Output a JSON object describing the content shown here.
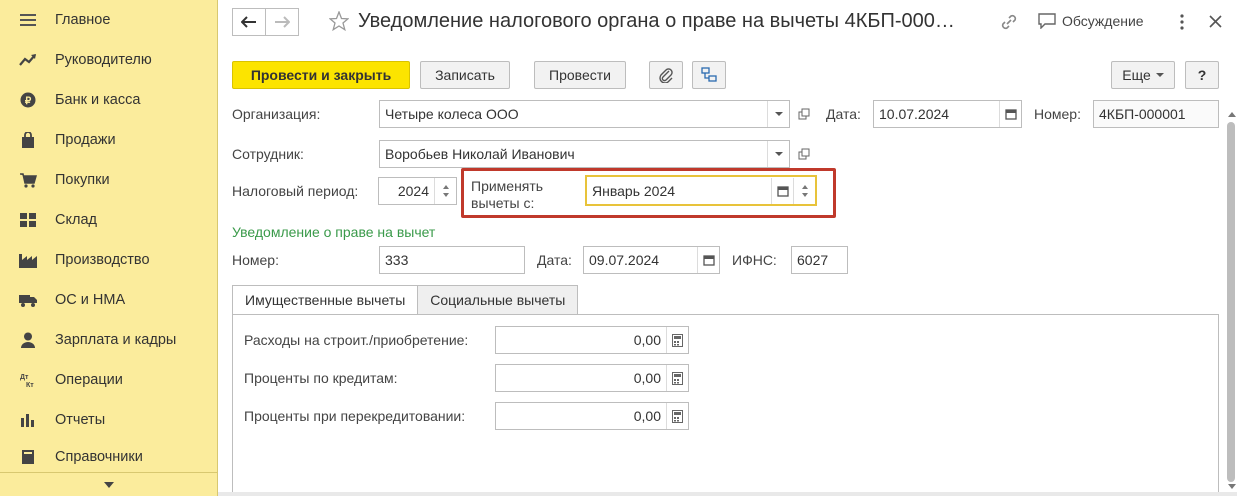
{
  "sidebar": {
    "items": [
      {
        "label": "Главное",
        "icon": "menu-lines-icon"
      },
      {
        "label": "Руководителю",
        "icon": "trend-icon"
      },
      {
        "label": "Банк и касса",
        "icon": "coin-icon"
      },
      {
        "label": "Продажи",
        "icon": "bag-icon"
      },
      {
        "label": "Покупки",
        "icon": "cart-icon"
      },
      {
        "label": "Склад",
        "icon": "warehouse-icon"
      },
      {
        "label": "Производство",
        "icon": "factory-icon"
      },
      {
        "label": "ОС и НМА",
        "icon": "truck-icon"
      },
      {
        "label": "Зарплата и кадры",
        "icon": "person-icon"
      },
      {
        "label": "Операции",
        "icon": "dt-kt-icon"
      },
      {
        "label": "Отчеты",
        "icon": "bar-chart-icon"
      },
      {
        "label": "Справочники",
        "icon": "book-icon"
      }
    ]
  },
  "header": {
    "title": "Уведомление налогового органа о праве на вычеты 4КБП-000…",
    "discussion": "Обсуждение"
  },
  "toolbar": {
    "post_close": "Провести и закрыть",
    "save": "Записать",
    "post": "Провести",
    "more": "Еще",
    "help": "?"
  },
  "form": {
    "org_label": "Организация:",
    "org_value": "Четыре колеса ООО",
    "date_label": "Дата:",
    "date_value": "10.07.2024",
    "number_label": "Номер:",
    "number_value": "4КБП-000001",
    "employee_label": "Сотрудник:",
    "employee_value": "Воробьев Николай Иванович",
    "period_label": "Налоговый период:",
    "period_value": "2024",
    "apply_label_1": "Применять",
    "apply_label_2": "вычеты с:",
    "apply_value": "Январь 2024"
  },
  "notice": {
    "title": "Уведомление о праве на вычет",
    "number_label": "Номер:",
    "number_value": "333",
    "date_label": "Дата:",
    "date_value": "09.07.2024",
    "ifns_label": "ИФНС:",
    "ifns_value": "6027"
  },
  "tabs": [
    {
      "label": "Имущественные вычеты",
      "active": true
    },
    {
      "label": "Социальные вычеты",
      "active": false
    }
  ],
  "property": {
    "rows": [
      {
        "label": "Расходы на строит./приобретение:",
        "value": "0,00"
      },
      {
        "label": "Проценты по кредитам:",
        "value": "0,00"
      },
      {
        "label": "Проценты при перекредитовании:",
        "value": "0,00"
      }
    ]
  },
  "colors": {
    "sidebar_bg": "#fbec9c",
    "primary_button": "#fce400",
    "section_title": "#3a9a4a",
    "highlight_border": "#c0392b",
    "active_field_border": "#e8c33a"
  }
}
